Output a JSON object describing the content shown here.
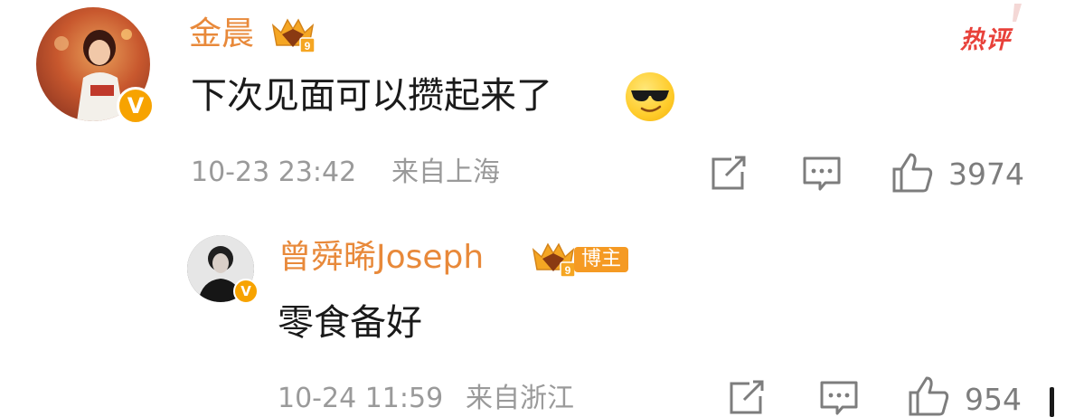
{
  "comment": {
    "username": "金晨",
    "hot_label": "热评",
    "text": "下次见面可以攒起来了",
    "emoji": "sunglasses-smile-emoji",
    "timestamp": "10-23 23:42",
    "location": "来自上海",
    "likes": "3974",
    "verified_badge": "V"
  },
  "reply": {
    "username": "曾舜晞Joseph",
    "role_badge": "博主",
    "text": "零食备好",
    "timestamp": "10-24 11:59",
    "location": "来自浙江",
    "likes": "954",
    "verified_badge": "V"
  },
  "colors": {
    "username": "#e8893a",
    "hot": "#e8413a",
    "badge": "#f7a300",
    "meta": "#9a9a9a"
  }
}
